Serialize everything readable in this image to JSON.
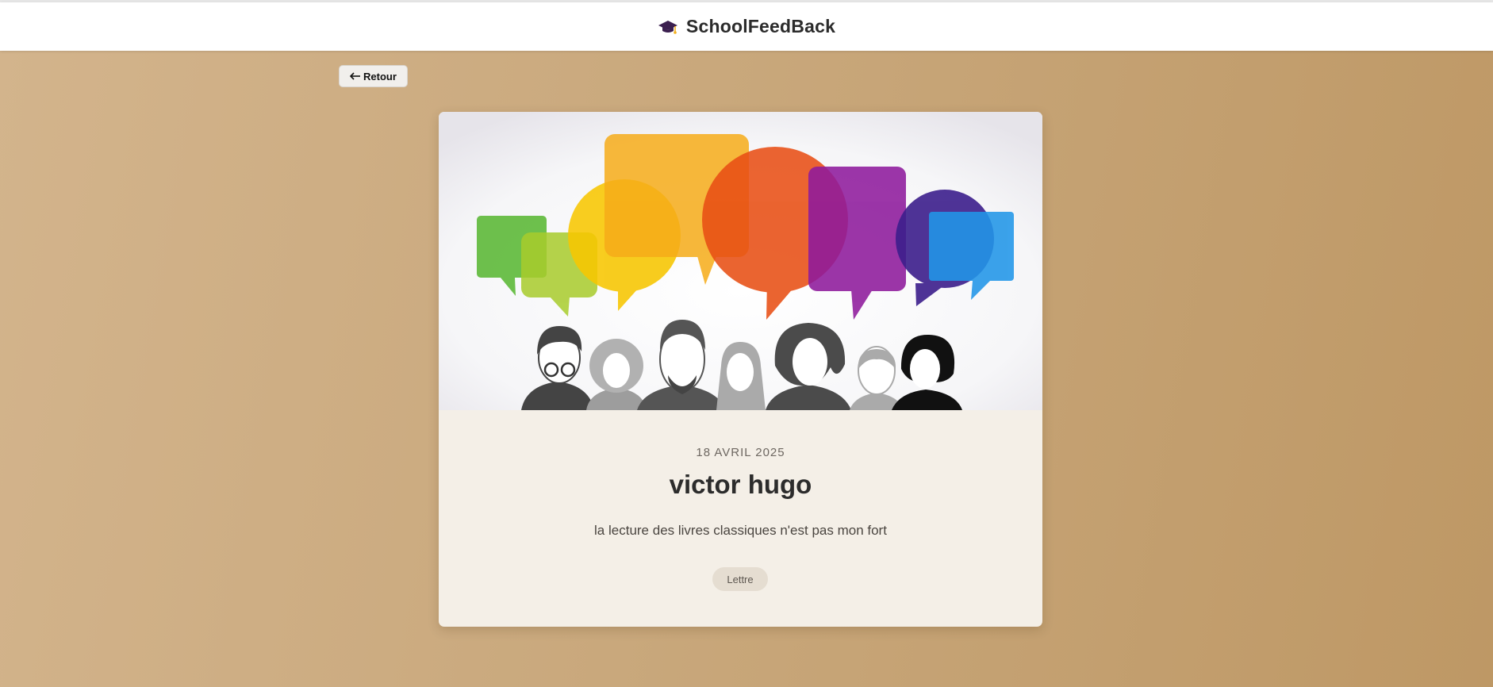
{
  "header": {
    "brand_icon": "graduation-cap-icon",
    "brand_name": "SchoolFeedBack"
  },
  "nav": {
    "back_icon": "arrow-left-icon",
    "back_label": "Retour"
  },
  "card": {
    "date": "18 AVRIL 2025",
    "author": "victor hugo",
    "excerpt": "la lecture des livres classiques n'est pas mon fort",
    "tag": "Lettre",
    "image": "speech-bubbles-people-illustration"
  },
  "colors": {
    "background_start": "#d3b48c",
    "background_end": "#be9865",
    "card_background": "#f4efe7",
    "bubble_green": "#5fba3a",
    "bubble_lime": "#a8cc2c",
    "bubble_yellow": "#f7c600",
    "bubble_orange": "#f6ac19",
    "bubble_red": "#e84f14",
    "bubble_purple": "#8e1a9c",
    "bubble_indigo": "#3c1e8c",
    "bubble_blue": "#2196e8"
  }
}
